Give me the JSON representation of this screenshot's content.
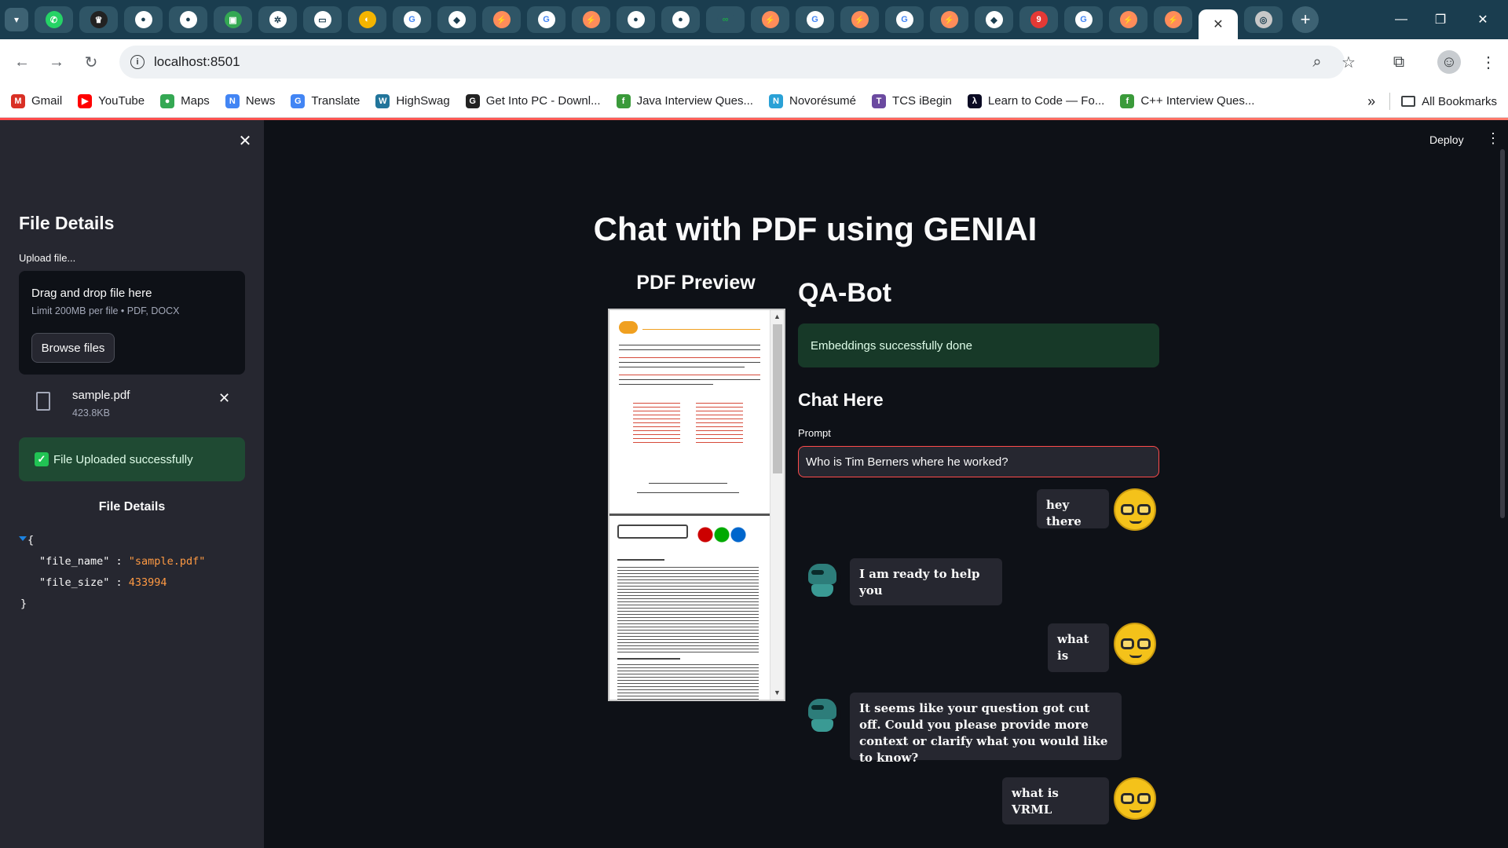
{
  "browser": {
    "active_tab_close": "✕",
    "new_tab": "+",
    "url": "localhost:8501",
    "bookmarks": [
      {
        "label": "Gmail",
        "icon": "gmail-icon",
        "color": "#d93025",
        "glyph": "M"
      },
      {
        "label": "YouTube",
        "icon": "youtube-icon",
        "color": "#ff0000",
        "glyph": "▶"
      },
      {
        "label": "Maps",
        "icon": "maps-icon",
        "color": "#34a853",
        "glyph": "●"
      },
      {
        "label": "News",
        "icon": "news-icon",
        "color": "#4285f4",
        "glyph": "N"
      },
      {
        "label": "Translate",
        "icon": "translate-icon",
        "color": "#4285f4",
        "glyph": "G"
      },
      {
        "label": "HighSwag",
        "icon": "wordpress-icon",
        "color": "#21759b",
        "glyph": "W"
      },
      {
        "label": "Get Into PC - Downl...",
        "icon": "getintopc-icon",
        "color": "#222222",
        "glyph": "G"
      },
      {
        "label": "Java Interview Ques...",
        "icon": "java-icon",
        "color": "#3a9a3a",
        "glyph": "f"
      },
      {
        "label": "Novorésumé",
        "icon": "novoresume-icon",
        "color": "#2aa1d6",
        "glyph": "N"
      },
      {
        "label": "TCS iBegin",
        "icon": "tcs-icon",
        "color": "#6b4aa0",
        "glyph": "T"
      },
      {
        "label": "Learn to Code — Fo...",
        "icon": "freecodecamp-icon",
        "color": "#0a0a23",
        "glyph": "λ"
      },
      {
        "label": "C++ Interview Ques...",
        "icon": "cpp-icon",
        "color": "#3a9a3a",
        "glyph": "f"
      }
    ],
    "bookmarks_overflow": "»",
    "all_bookmarks": "All Bookmarks",
    "tab_count": 27
  },
  "app": {
    "deploy_label": "Deploy",
    "main_title": "Chat with PDF using GENIAI",
    "sidebar": {
      "title": "File Details",
      "upload_label": "Upload file...",
      "dropzone_title": "Drag and drop file here",
      "dropzone_limit": "Limit 200MB per file • PDF, DOCX",
      "browse_button": "Browse files",
      "file_name": "sample.pdf",
      "file_size": "423.8KB",
      "success_message": "File Uploaded successfully",
      "details_title": "File Details",
      "json": {
        "file_name_key": "\"file_name\"",
        "file_name_value": "\"sample.pdf\"",
        "file_size_key": "\"file_size\"",
        "file_size_value": "433994"
      }
    },
    "pdf_preview_title": "PDF Preview",
    "qa": {
      "title": "QA-Bot",
      "embed_message": "Embeddings successfully done",
      "chat_title": "Chat Here",
      "prompt_label": "Prompt",
      "prompt_value": "Who is Tim Berners where he worked?"
    },
    "chat": [
      {
        "role": "user",
        "text": "hey there"
      },
      {
        "role": "bot",
        "text": "I am ready to help you"
      },
      {
        "role": "user",
        "text": "what is"
      },
      {
        "role": "bot",
        "text": "It seems like your question got cut off. Could you please provide more context or clarify what you would like to know?"
      },
      {
        "role": "user",
        "text": "what is VRML"
      }
    ]
  }
}
